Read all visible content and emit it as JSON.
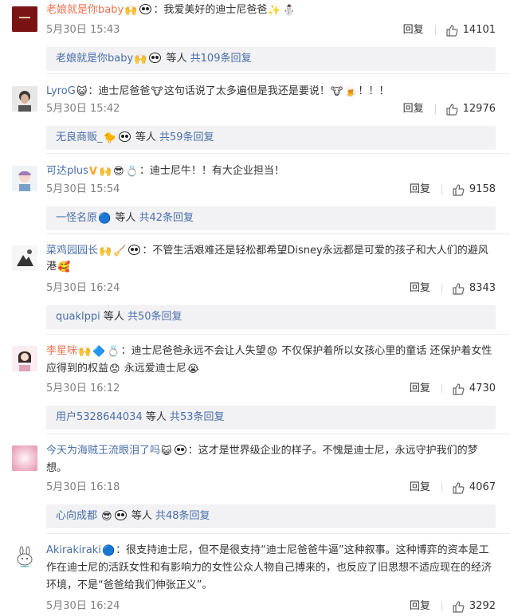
{
  "colors": {
    "link": "#eb7350",
    "blue": "#4a6ea9",
    "meta": "#808080",
    "subbg": "#f2f2f5"
  },
  "comments": [
    {
      "username": "老娘就是你baby",
      "text": "：我爱美好的迪士尼爸爸",
      "date": "5月30日 15:43",
      "reply": "回复",
      "likes": "14101",
      "sub_user": "老娘就是你baby",
      "sub_middle": "等人",
      "sub_total": "共109条回复"
    },
    {
      "username": "LyroG",
      "text_a": "：迪士尼爸爸",
      "text_b": "这句话说了太多遍但是我还是要说！",
      "text_c": "！！！",
      "date": "5月30日 15:42",
      "reply": "回复",
      "likes": "12976",
      "sub_user": "无良商贩_",
      "sub_middle": "等人",
      "sub_total": "共59条回复"
    },
    {
      "username": "可达plus",
      "text": "：迪士尼牛！！有大企业担当！",
      "date": "5月30日 15:54",
      "reply": "回复",
      "likes": "9158",
      "sub_user": "一怪名原",
      "sub_middle": "等人",
      "sub_total": "共42条回复"
    },
    {
      "username": "菜鸡园园长",
      "text_a": "：不管生活艰难还是轻松都希望Disney永远都是可爱的孩子和大人们的避风港",
      "date": "5月30日 16:24",
      "reply": "回复",
      "likes": "8343",
      "sub_user": "quaklppi",
      "sub_middle": "等人",
      "sub_total": "共50条回复"
    },
    {
      "username": "李星咪",
      "text_a": "：迪士尼爸爸永远不会让人失望",
      "text_b": "不仅保护着所以女孩心里的童话 还保护着女性应得到的权益",
      "text_c": "永远爱迪士尼",
      "date": "5月30日 16:12",
      "reply": "回复",
      "likes": "4730",
      "sub_user": "用户5328644034",
      "sub_middle": "等人",
      "sub_total": "共53条回复"
    },
    {
      "username": "今天为海贼王流眼泪了吗",
      "text": "：这才是世界级企业的样子。不愧是迪士尼，永远守护我们的梦想。",
      "date": "5月30日 16:18",
      "reply": "回复",
      "likes": "4067",
      "sub_user": "心向成都",
      "sub_middle": "等人",
      "sub_total": "共48条回复"
    },
    {
      "username": "Akirakiraki",
      "text": "：很支持迪士尼，但不是很支持“迪士尼爸爸牛逼”这种叙事。这种博弈的资本是工作在迪士尼的活跃女性和有影响力的女性公众人物自己搏来的，也反应了旧思想不适应现在的经济环境，不是“爸爸给我们伸张正义”。",
      "date": "5月30日 16:24",
      "reply": "回复",
      "likes": "3292"
    }
  ]
}
